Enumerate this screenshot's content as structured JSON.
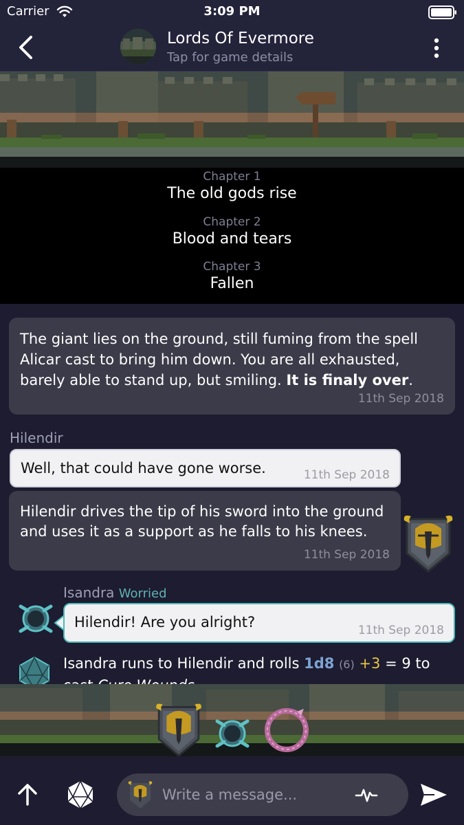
{
  "status_bar": {
    "carrier": "Carrier",
    "time": "3:09 PM"
  },
  "nav": {
    "title": "Lords Of Evermore",
    "subtitle": "Tap for game details"
  },
  "chapters": [
    {
      "label": "Chapter 1",
      "title": "The old gods rise"
    },
    {
      "label": "Chapter 2",
      "title": "Blood and tears"
    },
    {
      "label": "Chapter 3",
      "title": "Fallen"
    }
  ],
  "messages": {
    "narration": {
      "text": "The giant lies on the ground, still fuming from the spell Alicar cast to bring him down. You are all exhausted, barely able to stand up, but smiling. ",
      "emphasis": "It is finaly over",
      "end": ".",
      "date": "11th Sep 2018"
    },
    "hilendir": {
      "name": "Hilendir",
      "speech": "Well, that could have gone worse.",
      "speech_date": "11th Sep 2018",
      "action": "Hilendir drives the tip of his sword into the ground and uses it as a support as he falls to his knees.",
      "action_date": "11th Sep 2018"
    },
    "isandra": {
      "name": "Isandra",
      "mood": "Worried",
      "speech": "Hilendir! Are you alright?",
      "speech_date": "11th Sep 2018"
    },
    "roll": {
      "prefix": "Isandra runs to Hilendir and rolls ",
      "dice": "1d8",
      "raw": "(6)",
      "modifier": "+3",
      "equals": "= 9 to",
      "line2_prefix": "cast ",
      "spell": "Cure Wounds"
    }
  },
  "composer": {
    "placeholder": "Write a message..."
  },
  "colors": {
    "background": "#1d1c30",
    "bar": "#23233a",
    "bubble_dark": "#3b3b49",
    "bubble_light": "#f1f1f3",
    "isandra_accent": "#4bb8b8",
    "dice": "#7da3d2",
    "modifier": "#e8c547"
  },
  "icons": [
    "wifi-icon",
    "battery-icon",
    "back-chevron-icon",
    "more-vertical-icon",
    "helmet-icon",
    "shield-sigil-icon",
    "d20-dice-icon",
    "ouroboros-icon",
    "arrow-up-icon",
    "pulse-icon",
    "send-icon"
  ]
}
